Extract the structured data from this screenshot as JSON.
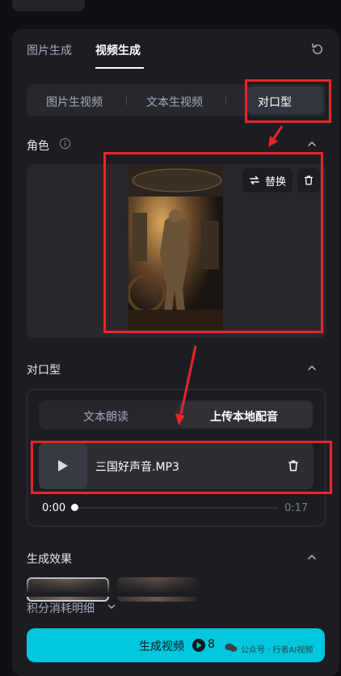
{
  "tabs": {
    "image_gen": "图片生成",
    "video_gen": "视频生成"
  },
  "subtabs": [
    "图片生视频",
    "文本生视频",
    "对口型"
  ],
  "role": {
    "title": "角色",
    "replace_label": "替换"
  },
  "lipsync": {
    "title": "对口型",
    "modes": {
      "read": "文本朗读",
      "upload": "上传本地配音"
    },
    "audio": {
      "file_name": "三国好声音.MP3",
      "time_start": "0:00",
      "time_end": "0:17",
      "progress": 0.0
    }
  },
  "effect": {
    "title": "生成效果"
  },
  "cost": {
    "detail_label": "积分消耗明细"
  },
  "generate": {
    "label": "生成视频",
    "cost": "8"
  },
  "watermark": {
    "text": "公众号 · 行者AI视频"
  },
  "colors": {
    "accent": "#00c6de",
    "highlight": "#e8252b",
    "panel": "#1c1d22"
  }
}
